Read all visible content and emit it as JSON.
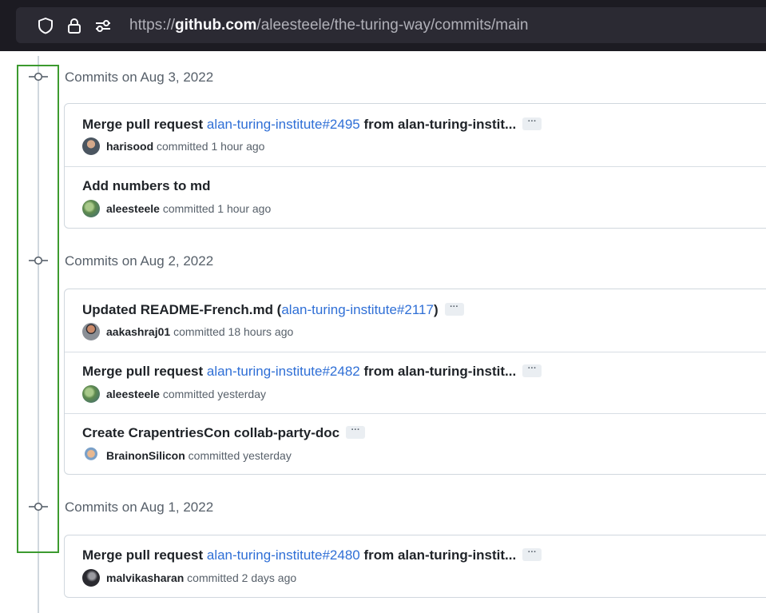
{
  "browser": {
    "url_prefix": "https://",
    "url_host": "github.com",
    "url_path": "/aleesteele/the-turing-way/commits/main",
    "icons": [
      "shield-icon",
      "lock-icon",
      "permissions-icon"
    ]
  },
  "groups": [
    {
      "title": "Commits on Aug 3, 2022",
      "commits": [
        {
          "title_prefix": "Merge pull request ",
          "title_link": "alan-turing-institute#2495",
          "title_suffix": " from alan-turing-instit...",
          "has_ellipsis": true,
          "author": "harisood",
          "meta": " committed 1 hour ago",
          "avatar_color": "#5a6b7a"
        },
        {
          "title_prefix": "Add numbers to md",
          "title_link": "",
          "title_suffix": "",
          "has_ellipsis": false,
          "author": "aleesteele",
          "meta": " committed 1 hour ago",
          "avatar_color": "#6f9a5a"
        }
      ]
    },
    {
      "title": "Commits on Aug 2, 2022",
      "commits": [
        {
          "title_prefix": "Updated README-French.md (",
          "title_link": "alan-turing-institute#2117",
          "title_suffix": ")",
          "has_ellipsis": true,
          "author": "aakashraj01",
          "meta": " committed 18 hours ago",
          "avatar_color": "#c0826a"
        },
        {
          "title_prefix": "Merge pull request ",
          "title_link": "alan-turing-institute#2482",
          "title_suffix": " from alan-turing-instit...",
          "has_ellipsis": true,
          "author": "aleesteele",
          "meta": " committed yesterday",
          "avatar_color": "#6f9a5a"
        },
        {
          "title_prefix": "Create CrapentriesCon collab-party-doc",
          "title_link": "",
          "title_suffix": "",
          "has_ellipsis": true,
          "author": "BrainonSilicon",
          "meta": " committed yesterday",
          "avatar_color": "#d39b5a"
        }
      ]
    },
    {
      "title": "Commits on Aug 1, 2022",
      "commits": [
        {
          "title_prefix": "Merge pull request ",
          "title_link": "alan-turing-institute#2480",
          "title_suffix": " from alan-turing-instit...",
          "has_ellipsis": true,
          "author": "malvikasharan",
          "meta": " committed 2 days ago",
          "avatar_color": "#3d3d45"
        }
      ]
    }
  ],
  "ellipsis_label": "···",
  "colors": {
    "link": "#2f6fd6",
    "highlight_box": "#3c9a2f",
    "urlbar_bg": "#1c1b22"
  }
}
